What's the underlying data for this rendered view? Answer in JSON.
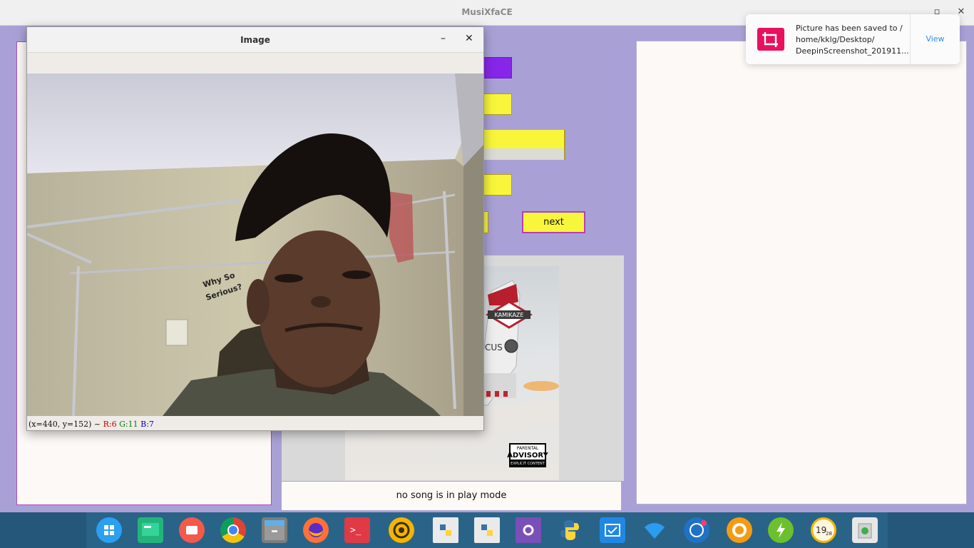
{
  "app": {
    "title": "MusiXfaCE",
    "maximize_glyph": "▫",
    "close_glyph": "✕"
  },
  "controls": {
    "next_label": "next"
  },
  "status": {
    "text": "no song is in play mode"
  },
  "album": {
    "badge_text": "KAMIKAZE",
    "partial_text": "CUS",
    "advisory_line1": "PARENTAL",
    "advisory_line2": "ADVISORY",
    "advisory_line3": "EXPLICIT CONTENT"
  },
  "image_window": {
    "title": "Image",
    "minimize_glyph": "–",
    "close_glyph": "✕",
    "coords_text": "(x=440, y=152) ~",
    "r_text": "R:6",
    "g_text": "G:11",
    "b_text": "B:7",
    "poster_text_line1": "Why So",
    "poster_text_line2": "Serious?"
  },
  "notification": {
    "line1": "Picture has been saved to /",
    "line2": "home/kklg/Desktop/",
    "line3": "DeepinScreenshot_201911...",
    "action_label": "View"
  },
  "dock": {
    "clock_hour": "19",
    "clock_min": "28",
    "terminal_glyph": ">_",
    "icons": [
      "launcher-icon",
      "desktop-icon",
      "screen-recorder-icon",
      "chrome-icon",
      "file-manager-icon",
      "firefox-icon",
      "terminal-icon",
      "sync-icon",
      "python-file-icon",
      "python-file-icon",
      "settings-file-icon",
      "python-icon",
      "updater-icon",
      "wifi-icon",
      "deepin-icon",
      "browser-icon",
      "power-icon",
      "clock-icon",
      "trash-icon"
    ]
  },
  "colors": {
    "background": "#a9a1d6",
    "button_yellow": "#f8f63b",
    "button_purple": "#8726e9",
    "notification_accent": "#e8105f",
    "view_link": "#2f8ee6"
  }
}
